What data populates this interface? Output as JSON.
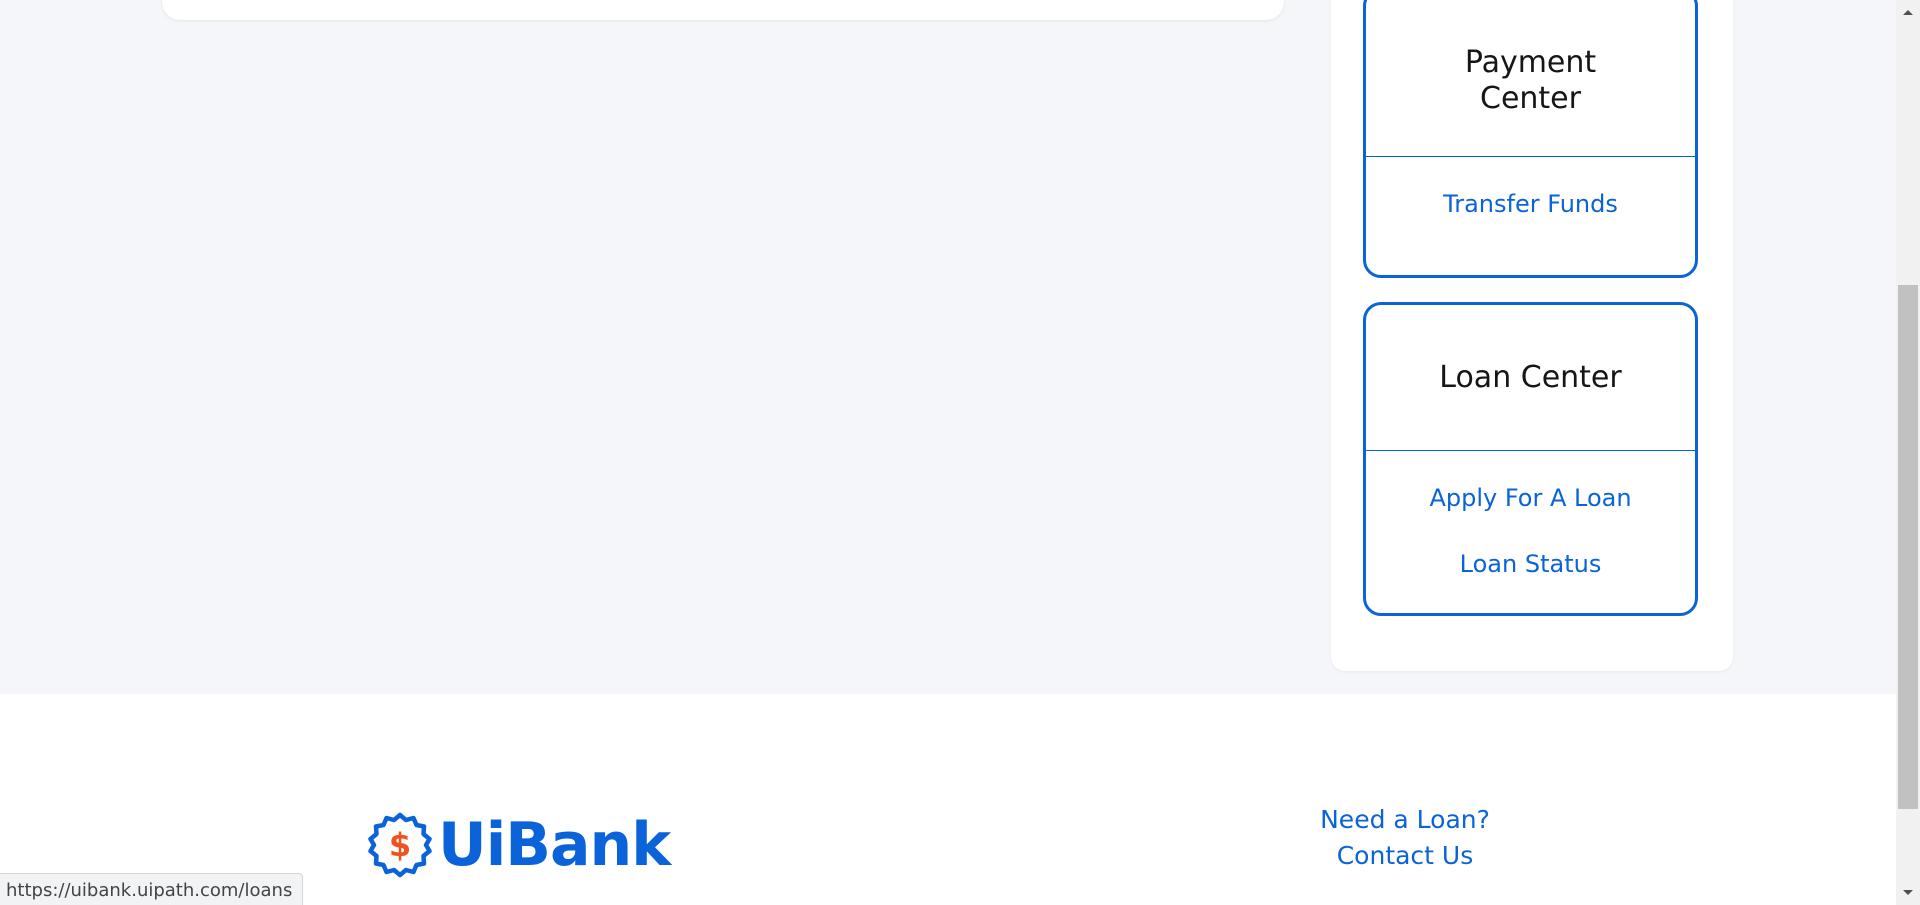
{
  "sidebar": {
    "payment_center": {
      "title": "Payment Center",
      "links": [
        "Transfer Funds"
      ]
    },
    "loan_center": {
      "title": "Loan Center",
      "links": [
        "Apply For A Loan",
        "Loan Status"
      ]
    }
  },
  "footer": {
    "logo_text": "UiBank",
    "logo_symbol": "$",
    "links": [
      "Need a Loan?",
      "Contact Us"
    ]
  },
  "status_bar": {
    "url": "https://uibank.uipath.com/loans"
  },
  "colors": {
    "brand_blue": "#0a63d8",
    "logo_accent": "#f0521e",
    "page_bg": "#f4f6f9"
  },
  "icons": {
    "logo": "dollar-badge-icon",
    "scroll_up": "chevron-up-icon",
    "scroll_down": "chevron-down-icon"
  }
}
